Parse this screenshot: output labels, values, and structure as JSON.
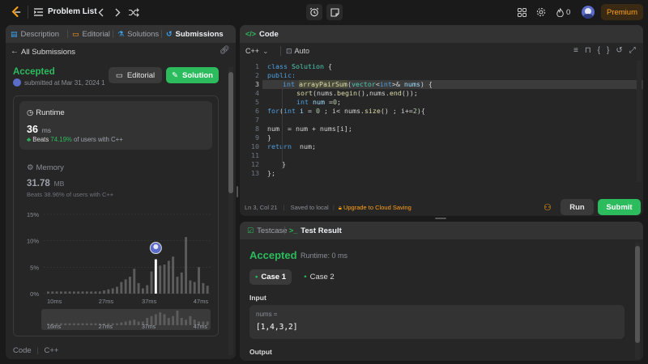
{
  "topnav": {
    "problem_list": "Problem List",
    "streak_count": "0",
    "premium": "Premium"
  },
  "left": {
    "tabs": [
      {
        "label": "Description"
      },
      {
        "label": "Editorial"
      },
      {
        "label": "Solutions"
      },
      {
        "label": "Submissions"
      }
    ],
    "all_submissions": "All Submissions",
    "status": "Accepted",
    "submitted_at": "submitted at Mar 31, 2024 1",
    "editorial_btn": "Editorial",
    "solution_btn": "Solution",
    "runtime": {
      "label": "Runtime",
      "value": "36",
      "unit": "ms",
      "beats_label": "Beats",
      "beats_pct": "74.19%",
      "beats_suffix": "of users with C++"
    },
    "memory": {
      "label": "Memory",
      "value": "31.78",
      "unit": "MB",
      "beats_text": "Beats 38.96% of users with C++"
    },
    "footer": {
      "code_label": "Code",
      "lang": "C++"
    }
  },
  "chart_data": {
    "type": "bar",
    "y_ticks": [
      "15%",
      "10%",
      "5%",
      "0%"
    ],
    "ylim": [
      0,
      15
    ],
    "x_ticks": [
      "10ms",
      "27ms",
      "37ms",
      "47ms"
    ],
    "overview_ticks": [
      "16ms",
      "27ms",
      "37ms",
      "47ms"
    ],
    "values": [
      0.4,
      0.4,
      0.4,
      0.4,
      0.4,
      0.4,
      0.4,
      0.4,
      0.4,
      0.4,
      0.4,
      0.4,
      0.4,
      0.6,
      0.8,
      1.0,
      1.3,
      2.2,
      2.7,
      3.2,
      4.7,
      2.0,
      1.0,
      1.6,
      4.2,
      6.5,
      5.3,
      5.5,
      6.2,
      7.0,
      3.2,
      4.0,
      10.7,
      2.5,
      2.2,
      5.0,
      2.0,
      1.5
    ],
    "highlight_index": 25,
    "overview_values": [
      1,
      1,
      1,
      1,
      1,
      1,
      1,
      1,
      1,
      1,
      1,
      1,
      1,
      1,
      1,
      1,
      1,
      1.5,
      2,
      2.5,
      3,
      2,
      2,
      4,
      5,
      6,
      7,
      6,
      4,
      5,
      8,
      4,
      3,
      5,
      3,
      2,
      2,
      2
    ]
  },
  "code": {
    "title": "Code",
    "lang": "C++",
    "auto": "Auto",
    "cursor": "Ln 3, Col 21",
    "saved": "Saved to local",
    "upgrade": "Upgrade to Cloud Saving",
    "run": "Run",
    "submit": "Submit",
    "lines": [
      {
        "n": "1"
      },
      {
        "n": "2"
      },
      {
        "n": "3"
      },
      {
        "n": "4"
      },
      {
        "n": "5"
      },
      {
        "n": "6"
      },
      {
        "n": "7"
      },
      {
        "n": "8"
      },
      {
        "n": "9"
      },
      {
        "n": "10"
      },
      {
        "n": "11"
      },
      {
        "n": "12"
      },
      {
        "n": "13"
      }
    ],
    "tokens": {
      "l1a": "class ",
      "l1b": "Solution",
      "l1c": " {",
      "l2": "public:",
      "l3a": "int ",
      "l3b": "arrayPairSum",
      "l3c": "(",
      "l3d": "vector",
      "l3e": "<",
      "l3f": "int",
      "l3g": ">& ",
      "l3h": "nums",
      "l3i": ") {",
      "l4a": "sort",
      "l4b": "(nums.",
      "l4c": "begin",
      "l4d": "(),nums.",
      "l4e": "end",
      "l4f": "());",
      "l5a": "int ",
      "l5b": "num ",
      "l5c": "=",
      "l5d": "0",
      "l5e": ";",
      "l6a": "for",
      "l6b": "(",
      "l6c": "int ",
      "l6d": "i ",
      "l6e": "= ",
      "l6f": "0",
      "l6g": " ; i< nums.",
      "l6h": "size",
      "l6i": "() ; i+=",
      "l6j": "2",
      "l6k": "){",
      "l8": "num  = num + nums[i];",
      "l9": "}",
      "l10a": "return",
      "l10b": "  num;",
      "l12": "}",
      "l13": "};"
    }
  },
  "testpanel": {
    "tab_testcase": "Testcase",
    "tab_result": "Test Result",
    "status": "Accepted",
    "runtime": "Runtime: 0 ms",
    "case1": "Case 1",
    "case2": "Case 2",
    "input_label": "Input",
    "var_label": "nums =",
    "var_value": "[1,4,3,2]",
    "output_label": "Output"
  },
  "colors": {
    "accent_green": "#2cbb5d",
    "brand_orange": "#ffa116",
    "bg": "#1a1a1a",
    "panel": "#262626"
  }
}
